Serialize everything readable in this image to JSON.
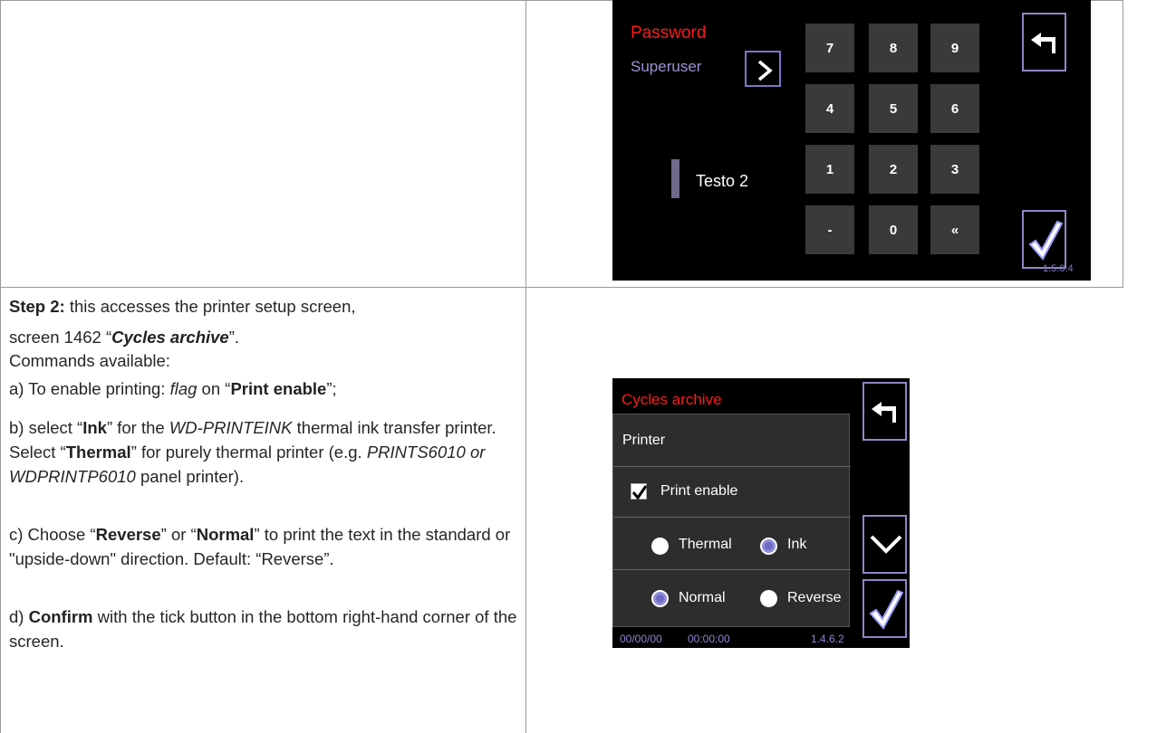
{
  "screen1": {
    "password_label": "Password",
    "user_label": "Superuser",
    "text_label": "Testo 2",
    "keys": [
      "7",
      "8",
      "9",
      "4",
      "5",
      "6",
      "1",
      "2",
      "3",
      "-",
      "0",
      "«"
    ],
    "version": "1.5.0.4"
  },
  "doc": {
    "step_label": "Step 2:",
    "step_text": " this accesses the printer setup screen,",
    "screen_line_a": "screen 1462 “",
    "screen_name": "Cycles archive",
    "screen_line_b": "”.",
    "commands": "Commands available:",
    "a_pre": "a) To enable printing: ",
    "a_flag": "flag",
    "a_mid": " on “",
    "a_bold": "Print enable",
    "a_post": "”;",
    "b_pre": "b) select “",
    "b_ink": "Ink",
    "b_mid1": "” for the ",
    "b_model": "WD-PRINTEINK",
    "b_mid2": " thermal ink transfer printer. Select “",
    "b_thermal": "Thermal",
    "b_mid3": "” for purely thermal printer (e.g. ",
    "b_models2": "PRINTS6010 or WDPRINTP6010",
    "b_post": " panel printer).",
    "c_pre": "c) Choose “",
    "c_reverse": "Reverse",
    "c_mid": "” or “",
    "c_normal": "Normal",
    "c_post": "” to print the text in the standard or \"upside-down\" direction. Default: “Reverse”.",
    "d_pre": "d) ",
    "d_bold": "Confirm",
    "d_post": " with the tick button in the bottom right-hand corner of the screen."
  },
  "screen2": {
    "title": "Cycles archive",
    "section": "Printer",
    "print_enable": "Print enable",
    "print_enable_checked": true,
    "thermal": "Thermal",
    "ink": "Ink",
    "normal": "Normal",
    "reverse": "Reverse",
    "selected_type": "Ink",
    "selected_direction": "Normal",
    "date": "00/00/00",
    "time": "00:00:00",
    "version": "1.4.6.2"
  },
  "colors": {
    "title_red": "#ff1a1a",
    "accent_purple": "#8f8cd8"
  }
}
